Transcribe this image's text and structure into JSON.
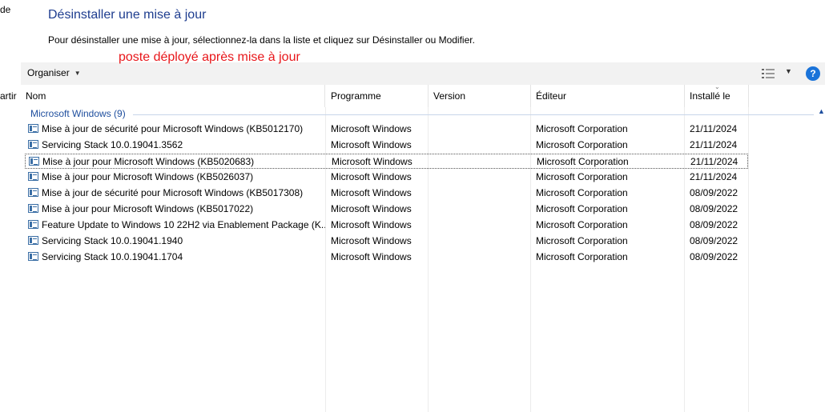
{
  "left_stub": {
    "top": "de",
    "mid": "artir"
  },
  "header": {
    "title": "Désinstaller une mise à jour",
    "instructions": "Pour désinstaller une mise à jour, sélectionnez-la dans la liste et cliquez sur Désinstaller ou Modifier.",
    "annotation": "poste déployé après mise à jour"
  },
  "toolbar": {
    "organize_label": "Organiser",
    "help_label": "?"
  },
  "columns": [
    "Nom",
    "Programme",
    "Version",
    "Éditeur",
    "Installé le"
  ],
  "group": {
    "label": "Microsoft Windows (9)"
  },
  "rows": [
    {
      "name": "Mise à jour de sécurité pour Microsoft Windows (KB5012170)",
      "program": "Microsoft Windows",
      "version": "",
      "publisher": "Microsoft Corporation",
      "installed": "21/11/2024"
    },
    {
      "name": "Servicing Stack 10.0.19041.3562",
      "program": "Microsoft Windows",
      "version": "",
      "publisher": "Microsoft Corporation",
      "installed": "21/11/2024"
    },
    {
      "name": "Mise à jour pour Microsoft Windows (KB5020683)",
      "program": "Microsoft Windows",
      "version": "",
      "publisher": "Microsoft Corporation",
      "installed": "21/11/2024"
    },
    {
      "name": "Mise à jour pour Microsoft Windows (KB5026037)",
      "program": "Microsoft Windows",
      "version": "",
      "publisher": "Microsoft Corporation",
      "installed": "21/11/2024"
    },
    {
      "name": "Mise à jour de sécurité pour Microsoft Windows (KB5017308)",
      "program": "Microsoft Windows",
      "version": "",
      "publisher": "Microsoft Corporation",
      "installed": "08/09/2022"
    },
    {
      "name": "Mise à jour pour Microsoft Windows (KB5017022)",
      "program": "Microsoft Windows",
      "version": "",
      "publisher": "Microsoft Corporation",
      "installed": "08/09/2022"
    },
    {
      "name": "Feature Update to Windows 10 22H2 via Enablement Package (K...",
      "program": "Microsoft Windows",
      "version": "",
      "publisher": "Microsoft Corporation",
      "installed": "08/09/2022"
    },
    {
      "name": "Servicing Stack 10.0.19041.1940",
      "program": "Microsoft Windows",
      "version": "",
      "publisher": "Microsoft Corporation",
      "installed": "08/09/2022"
    },
    {
      "name": "Servicing Stack 10.0.19041.1704",
      "program": "Microsoft Windows",
      "version": "",
      "publisher": "Microsoft Corporation",
      "installed": "08/09/2022"
    }
  ],
  "colors": {
    "title": "#1e3d8f",
    "annotation": "#e8171b",
    "group": "#1e4e9e",
    "help": "#1a73d9"
  }
}
